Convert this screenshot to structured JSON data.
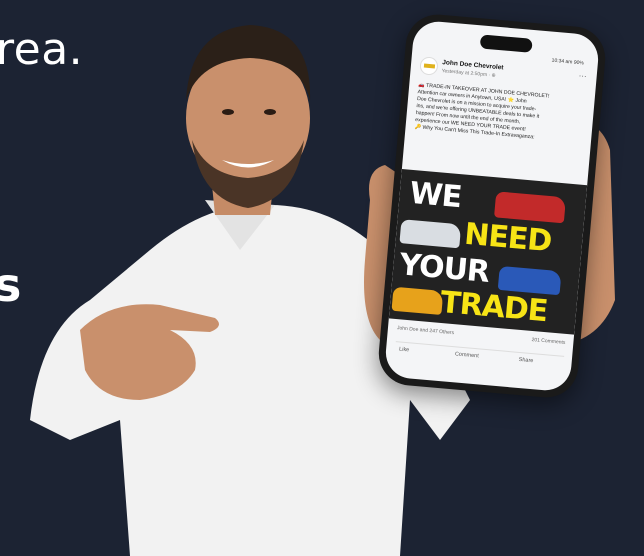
{
  "background_text": {
    "line1": "rea.",
    "line2": "s"
  },
  "phone_post": {
    "page_name": "John Doe Chevrolet",
    "post_meta": "Yesterday at 2:50pm · ⊕",
    "status_bar": "10:34 am  90%",
    "body_lines": [
      "🚗 TRADE-IN TAKEOVER AT JOHN DOE CHEVROLET!",
      "Attention car owners in Anytown, USA! ⭐ John",
      "Doe Chevrolet is on a mission to acquire your trade-",
      "ins, and we're offering UNBEATABLE deals to make it",
      "happen! From now until the end of the month,",
      "experience our WE NEED YOUR TRADE event!",
      "🔑 Why You Can't Miss This Trade-In Extravaganza:"
    ],
    "ad_words": [
      "WE",
      "NEED",
      "YOUR",
      "TRADE"
    ],
    "reactions_left": "John Doe and 247 Others",
    "reactions_right": "201 Comments",
    "action_like": "Like",
    "action_comment": "Comment",
    "action_share": "Share"
  }
}
